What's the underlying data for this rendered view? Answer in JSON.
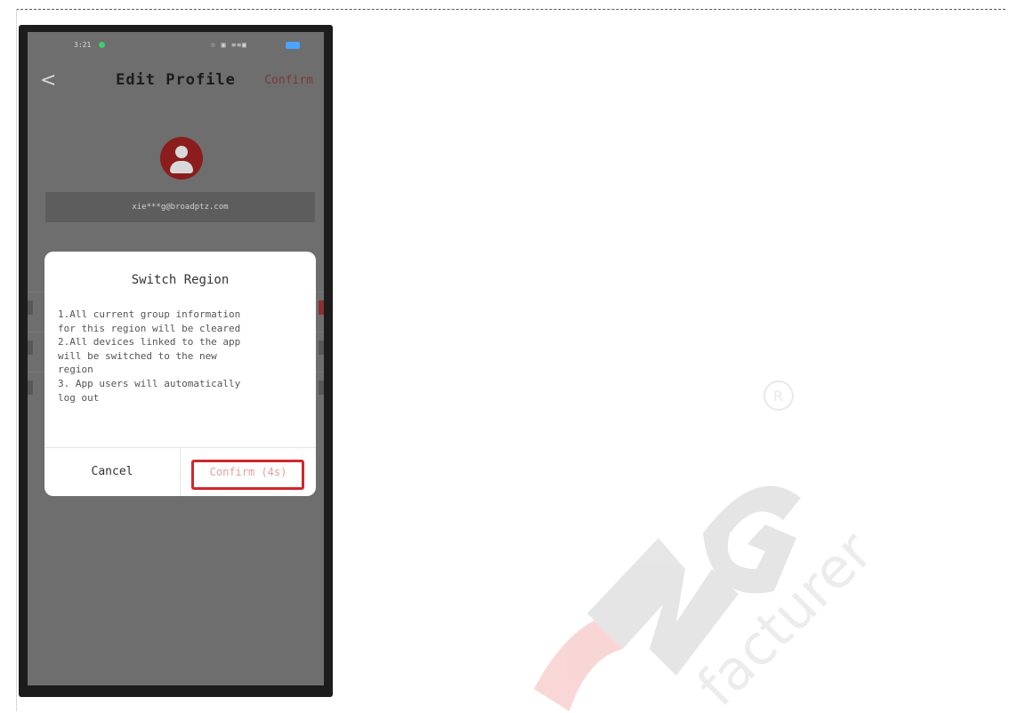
{
  "status_bar": {
    "time": "3:21",
    "icons": "☉ ▣ ≡≡▣",
    "battery": "64"
  },
  "nav": {
    "back": "<",
    "title": "Edit Profile",
    "confirm": "Confirm"
  },
  "profile": {
    "email": "xie***g@broadptz.com"
  },
  "dialog": {
    "title": "Switch Region",
    "lines": [
      "1.All current group information",
      "for this region will be cleared",
      "2.All devices linked to the app",
      "will be switched to the new",
      "region",
      "3. App users will automatically",
      "log out"
    ],
    "cancel": "Cancel",
    "confirm": "Confirm (4s)"
  },
  "watermark": {
    "brand": "NG",
    "tagline": "facturer",
    "registered": "R"
  },
  "colors": {
    "accent": "#d0262c",
    "brand_red": "#8b1d1d"
  }
}
